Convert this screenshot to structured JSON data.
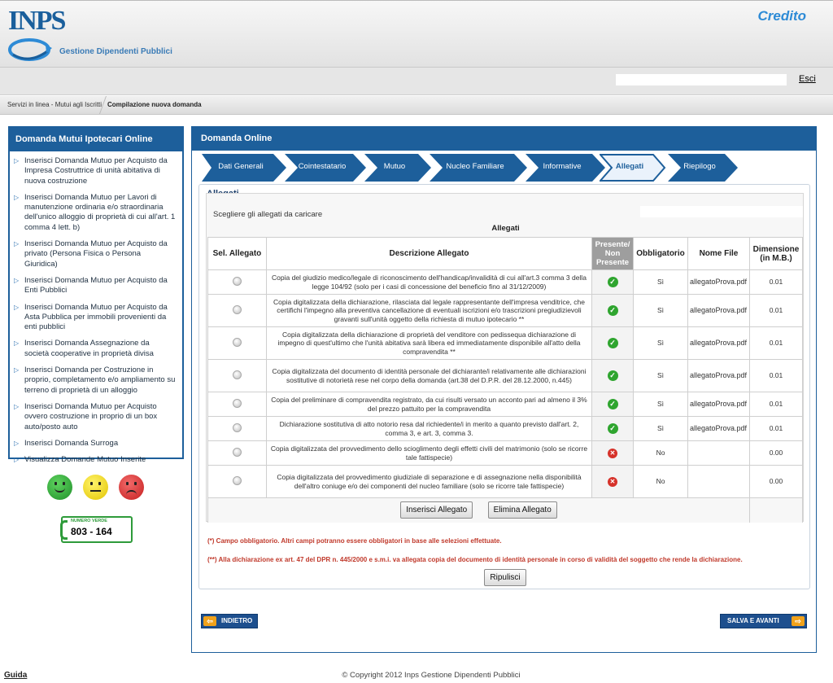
{
  "header": {
    "logo_text": "INPS",
    "subtitle": "Gestione Dipendenti Pubblici",
    "service_title": "Credito"
  },
  "utility": {
    "search_value": "",
    "exit_label": "Esci"
  },
  "breadcrumb": {
    "items": [
      "Servizi in linea - Mutui agli Iscritti",
      "Compilazione nuova domanda"
    ]
  },
  "sidebar": {
    "title": "Domanda Mutui Ipotecari Online",
    "items": [
      {
        "label": "Inserisci Domanda Mutuo per Acquisto da Impresa Costruttrice di unità abitativa di nuova costruzione"
      },
      {
        "label": "Inserisci Domanda Mutuo per Lavori di manutenzione ordinaria e/o straordinaria dell'unico alloggio di proprietà di cui all'art. 1 comma 4 lett. b)"
      },
      {
        "label": "Inserisci Domanda Mutuo per Acquisto da privato (Persona Fisica o Persona Giuridica)"
      },
      {
        "label": "Inserisci Domanda Mutuo per Acquisto da Enti Pubblici"
      },
      {
        "label": "Inserisci Domanda Mutuo per Acquisto da Asta Pubblica per immobili provenienti da enti pubblici"
      },
      {
        "label": "Inserisci Domanda Assegnazione da società cooperative in proprietà divisa"
      },
      {
        "label": "Inserisci Domanda per Costruzione in proprio, completamento e/o ampliamento su terreno di proprietà di un alloggio"
      },
      {
        "label": "Inserisci Domanda Mutuo per Acquisto ovvero costruzione in proprio di un box auto/posto auto"
      },
      {
        "label": "Inserisci Domanda Surroga"
      },
      {
        "label": "Visualizza Domande Mutuo Inserite"
      }
    ]
  },
  "numero_verde": {
    "label": "NUMERO VERDE",
    "number": "803 - 164"
  },
  "main": {
    "title": "Domanda Online",
    "steps": [
      {
        "label": "Dati Generali"
      },
      {
        "label": "Cointestatario"
      },
      {
        "label": "Mutuo"
      },
      {
        "label": "Nucleo Familiare"
      },
      {
        "label": "Informative"
      },
      {
        "label": "Allegati"
      },
      {
        "label": "Riepilogo"
      }
    ],
    "active_step": "Allegati",
    "section_title": "Allegati",
    "instruction": "Scegliere gli allegati da caricare",
    "table_caption": "Allegati",
    "columns": {
      "select": "Sel. Allegato",
      "description": "Descrizione Allegato",
      "present": "Presente/ Non Presente",
      "required": "Obbligatorio",
      "file_name": "Nome File",
      "size": "Dimensione (in M.B.)"
    },
    "rows": [
      {
        "description": "Copia del giudizio medico/legale di riconoscimento dell'handicap/invalidità di cui all'art.3 comma 3 della legge 104/92 (solo per i casi di concessione del beneficio fino al 31/12/2009)",
        "present": true,
        "required": "Sì",
        "file_name": "allegatoProva.pdf",
        "size": "0.01"
      },
      {
        "description": "Copia digitalizzata della dichiarazione, rilasciata dal legale rappresentante dell'impresa venditrice, che certifichi l'impegno alla preventiva cancellazione di eventuali iscrizioni e/o trascrizioni pregiudizievoli gravanti sull'unità oggetto della richiesta di mutuo ipotecario **",
        "present": true,
        "required": "Sì",
        "file_name": "allegatoProva.pdf",
        "size": "0.01"
      },
      {
        "description": "Copia digitalizzata della dichiarazione di proprietà del venditore con pedissequa dichiarazione di impegno di quest'ultimo che l'unità abitativa sarà libera ed immediatamente disponibile all'atto della compravendita **",
        "present": true,
        "required": "Sì",
        "file_name": "allegatoProva.pdf",
        "size": "0.01"
      },
      {
        "description": "Copia digitalizzata del documento di identità personale del dichiarante/i relativamente alle dichiarazioni sostitutive di notorietà rese nel corpo della domanda (art.38 del D.P.R. del 28.12.2000, n.445)",
        "present": true,
        "required": "Sì",
        "file_name": "allegatoProva.pdf",
        "size": "0.01"
      },
      {
        "description": "Copia del preliminare di compravendita registrato, da cui risulti versato un acconto pari ad almeno il 3% del prezzo pattuito per la compravendita",
        "present": true,
        "required": "Sì",
        "file_name": "allegatoProva.pdf",
        "size": "0.01"
      },
      {
        "description": "Dichiarazione sostitutiva di atto notorio resa dal richiedente/i in merito a quanto previsto dall'art. 2, comma 3, e art. 3, comma 3.",
        "present": true,
        "required": "Sì",
        "file_name": "allegatoProva.pdf",
        "size": "0.01"
      },
      {
        "description": "Copia digitalizzata del provvedimento dello scioglimento degli effetti civili del matrimonio (solo se ricorre tale fattispecie)",
        "present": false,
        "required": "No",
        "file_name": "",
        "size": "0.00"
      },
      {
        "description": "Copia digitalizzata del provvedimento giudiziale di separazione e di assegnazione nella disponibilità dell'altro coniuge e/o dei componenti del nucleo familiare (solo se ricorre tale fattispecie)",
        "present": false,
        "required": "No",
        "file_name": "",
        "size": "0.00"
      }
    ],
    "insert_button": "Inserisci Allegato",
    "delete_button": "Elimina Allegato",
    "note1": "(*) Campo obbligatorio. Altri campi potranno essere obbligatori in base alle selezioni effettuate.",
    "note2": "(**) Alla dichiarazione ex art. 47 del DPR n. 445/2000 e s.m.i. va allegata copia del documento di identità personale in corso di validità del soggetto che rende la dichiarazione.",
    "reset_button": "Ripulisci",
    "back_button": "INDIETRO",
    "next_button": "SALVA E AVANTI"
  },
  "footer": {
    "guide_link": "Guida",
    "copyright": "© Copyright 2012 Inps Gestione Dipendenti Pubblici"
  },
  "colors": {
    "brand_blue": "#1d5f9b",
    "accent_blue": "#2e8bd6",
    "note_red": "#c0392b",
    "ok_green": "#2fa52f",
    "ko_red": "#d6322a"
  }
}
